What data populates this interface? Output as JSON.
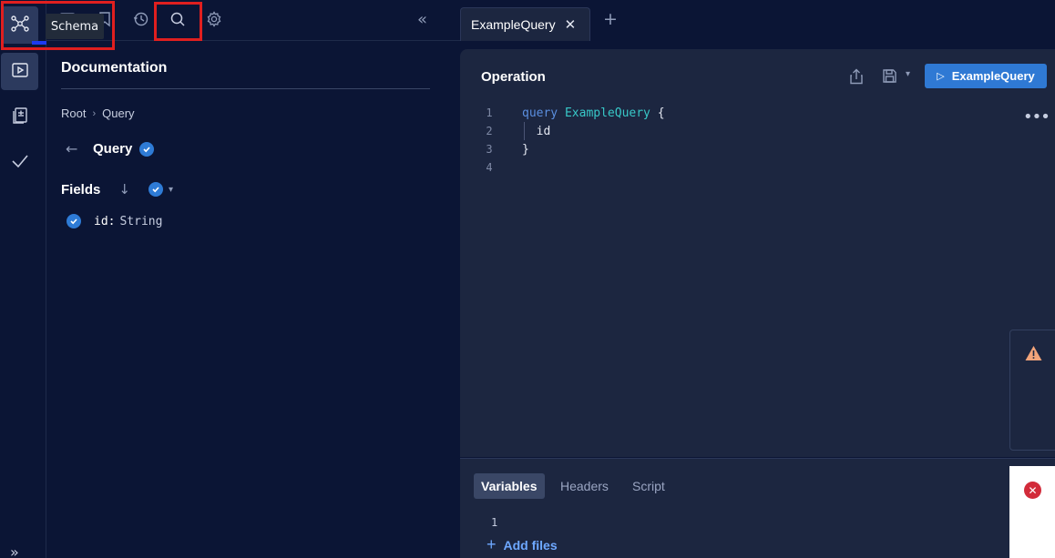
{
  "tooltip": {
    "text": "Schema"
  },
  "sidebar": {
    "items": [
      {
        "icon": "schema-graph-icon",
        "active": true
      },
      {
        "icon": "play-panel-icon",
        "active": true
      },
      {
        "icon": "collections-icon",
        "active": false
      },
      {
        "icon": "checkmark-icon",
        "active": false
      }
    ],
    "expand_label": "»"
  },
  "doc_toolbar": {
    "icons": [
      "explorer-icon",
      "bookmark-icon",
      "history-icon",
      "search-icon",
      "settings-icon"
    ],
    "collapse_label": "«"
  },
  "documentation": {
    "title": "Documentation",
    "breadcrumb": [
      "Root",
      "Query"
    ],
    "back_label": "Query",
    "fields_label": "Fields",
    "fields": [
      {
        "name": "id:",
        "type": "String"
      }
    ]
  },
  "tabs": [
    {
      "label": "ExampleQuery",
      "close": "✕"
    }
  ],
  "add_tab_label": "+",
  "operation": {
    "title": "Operation",
    "run_label": "ExampleQuery",
    "more_label": "•••",
    "lines": [
      {
        "num": "1",
        "kw": "query ",
        "name": "ExampleQuery",
        "rest": " {"
      },
      {
        "num": "2",
        "kw": "",
        "name": "",
        "rest": "  id"
      },
      {
        "num": "3",
        "kw": "",
        "name": "",
        "rest": "}"
      },
      {
        "num": "4",
        "kw": "",
        "name": "",
        "rest": ""
      }
    ]
  },
  "bottom_panel": {
    "tabs": [
      "Variables",
      "Headers",
      "Script"
    ],
    "active_tab": "Variables",
    "line_number": "1",
    "add_files_label": "Add files"
  },
  "colors": {
    "background": "#0b1535",
    "panel": "#1c2640",
    "accent": "#2f79d4",
    "highlight_box": "#e01f1f",
    "error": "#d22b3a",
    "warning": "#f0a070"
  }
}
